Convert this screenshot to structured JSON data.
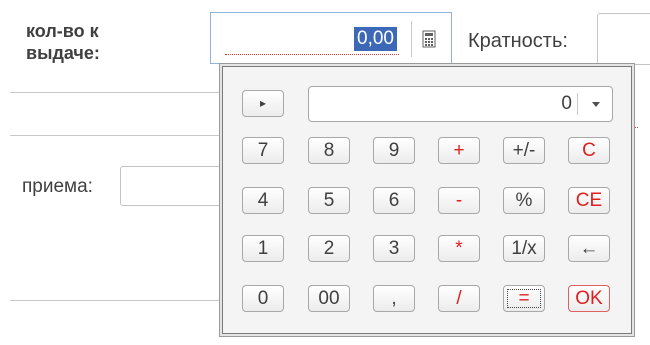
{
  "form": {
    "qty_label": "кол-во к выдаче:",
    "qty_value": "0,00",
    "krat_label": "Кратность:",
    "priema_label": "приема:"
  },
  "calculator": {
    "display_value": "0",
    "mode_toggle": "▸",
    "keys": [
      "7",
      "8",
      "9",
      "+",
      "+/-",
      "C",
      "4",
      "5",
      "6",
      "-",
      "%",
      "CE",
      "1",
      "2",
      "3",
      "*",
      "1/x",
      "←",
      "0",
      "00",
      ",",
      "/",
      "=",
      "OK"
    ]
  },
  "colors": {
    "selection": "#3d68b8",
    "operator_red": "#e02020",
    "text": "#404040"
  },
  "icons": {
    "calc_button": "calculator-icon",
    "display_dropdown": "chevron-down-icon"
  }
}
